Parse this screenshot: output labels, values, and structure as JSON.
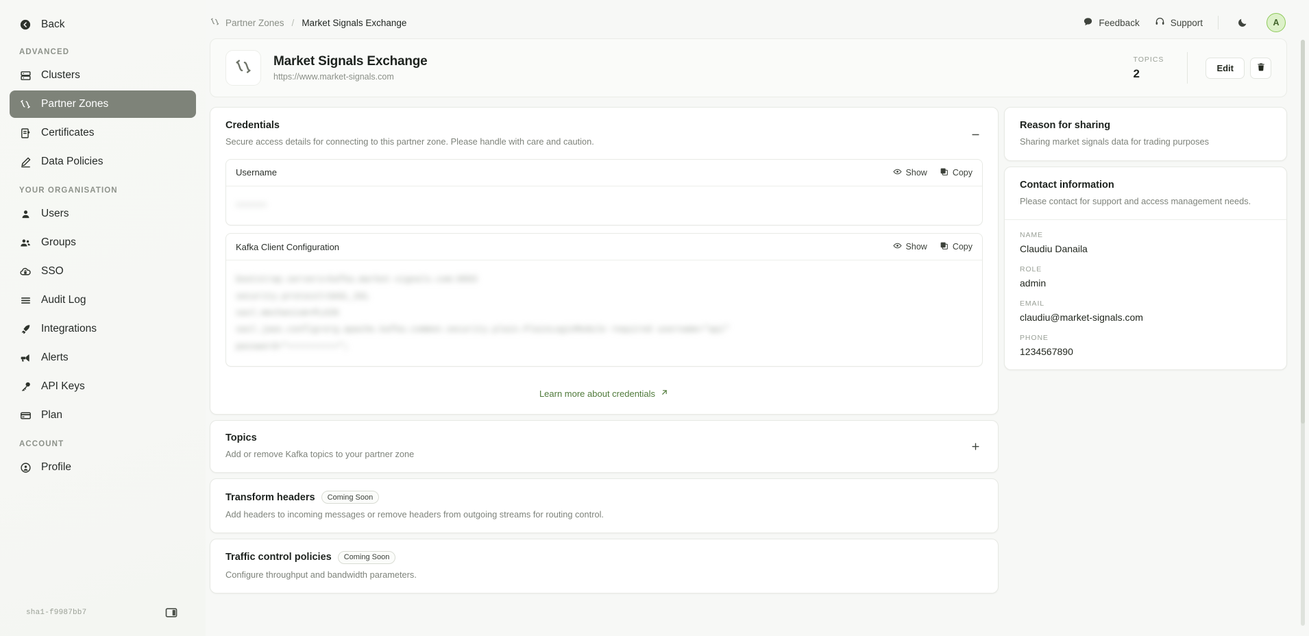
{
  "sidebar": {
    "back_label": "Back",
    "sections": [
      {
        "label": "ADVANCED",
        "items": [
          {
            "label": "Clusters",
            "icon": "server-icon",
            "active": false
          },
          {
            "label": "Partner Zones",
            "icon": "zigzag-arrow-icon",
            "active": true
          },
          {
            "label": "Certificates",
            "icon": "certificate-icon",
            "active": false
          },
          {
            "label": "Data Policies",
            "icon": "pencil-icon",
            "active": false
          }
        ]
      },
      {
        "label": "YOUR ORGANISATION",
        "items": [
          {
            "label": "Users",
            "icon": "user-icon",
            "active": false
          },
          {
            "label": "Groups",
            "icon": "users-group-icon",
            "active": false
          },
          {
            "label": "SSO",
            "icon": "cloud-lock-icon",
            "active": false
          },
          {
            "label": "Audit Log",
            "icon": "list-lines-icon",
            "active": false
          },
          {
            "label": "Integrations",
            "icon": "rocket-icon",
            "active": false
          },
          {
            "label": "Alerts",
            "icon": "megaphone-icon",
            "active": false
          },
          {
            "label": "API Keys",
            "icon": "key-icon",
            "active": false
          },
          {
            "label": "Plan",
            "icon": "credit-card-icon",
            "active": false
          }
        ]
      },
      {
        "label": "ACCOUNT",
        "items": [
          {
            "label": "Profile",
            "icon": "profile-circle-icon",
            "active": false
          }
        ]
      }
    ],
    "build_hash": "sha1-f9987bb7"
  },
  "topbar": {
    "breadcrumb_root": "Partner Zones",
    "breadcrumb_sep": "/",
    "breadcrumb_current": "Market Signals Exchange",
    "feedback_label": "Feedback",
    "support_label": "Support",
    "theme_toggle_icon": "moon-icon",
    "avatar_initial": "A"
  },
  "header": {
    "logo_icon": "zigzag-arrow-icon",
    "title": "Market Signals Exchange",
    "url": "https://www.market-signals.com",
    "topics_label": "TOPICS",
    "topics_value": "2",
    "edit_label": "Edit",
    "delete_icon": "trash-icon"
  },
  "credentials": {
    "title": "Credentials",
    "description": "Secure access details for connecting to this partner zone. Please handle with care and caution.",
    "collapse_icon": "minus-icon",
    "show_label": "Show",
    "copy_label": "Copy",
    "fields": [
      {
        "name": "Username",
        "masked_value": "••••••",
        "lines": 1
      },
      {
        "name": "Kafka Client Configuration",
        "masked_value": "bootstrap.servers=kafka.market-signals.com:9093\nsecurity.protocol=SASL_SSL\nsasl.mechanism=PLAIN\nsasl.jaas.config=org.apache.kafka.common.security.plain.PlainLoginModule required username=\"api\"\npassword=\"••••••••••\";",
        "lines": 5
      }
    ],
    "learn_more_label": "Learn more about credentials",
    "learn_more_icon": "external-link-icon"
  },
  "sections": [
    {
      "title": "Topics",
      "description": "Add or remove Kafka topics to your partner zone",
      "badge": "",
      "action_icon": "plus-icon"
    },
    {
      "title": "Transform headers",
      "description": "Add headers to incoming messages or remove headers from outgoing streams for routing control.",
      "badge": "Coming Soon",
      "action_icon": ""
    },
    {
      "title": "Traffic control policies",
      "description": "Configure throughput and bandwidth parameters.",
      "badge": "Coming Soon",
      "action_icon": ""
    }
  ],
  "reason": {
    "title": "Reason for sharing",
    "text": "Sharing market signals data for trading purposes"
  },
  "contact": {
    "title": "Contact information",
    "description": "Please contact for support and access management needs.",
    "fields": [
      {
        "label": "NAME",
        "value": "Claudiu Danaila"
      },
      {
        "label": "ROLE",
        "value": "admin"
      },
      {
        "label": "EMAIL",
        "value": "claudiu@market-signals.com"
      },
      {
        "label": "PHONE",
        "value": "1234567890"
      }
    ]
  },
  "colors": {
    "sidebar_active": "#7e8379",
    "accent_link": "#4f7a3a",
    "avatar_bg": "#ddf1c9",
    "avatar_border": "#8ec95a",
    "page_bg": "#f7f8f6"
  }
}
